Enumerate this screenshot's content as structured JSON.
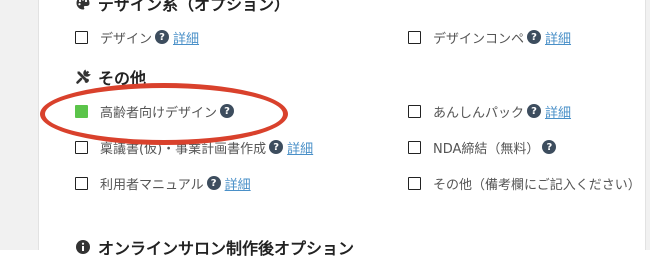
{
  "sections": {
    "design": {
      "title": "デザイン系（オプション）"
    },
    "other": {
      "title": "その他"
    },
    "online": {
      "title": "オンラインサロン制作後オプション"
    }
  },
  "link_label": "詳細",
  "help_glyph": "?",
  "design_options": [
    {
      "label": "デザイン",
      "checked": false,
      "help": true,
      "link": true
    },
    {
      "label": "デザインコンペ",
      "checked": false,
      "help": true,
      "link": true
    }
  ],
  "other_options": [
    {
      "label": "高齢者向けデザイン",
      "checked": true,
      "help": true,
      "link": false
    },
    {
      "label": "あんしんパック",
      "checked": false,
      "help": true,
      "link": true
    },
    {
      "label": "稟議書(仮)・事業計画書作成",
      "checked": false,
      "help": true,
      "link": true
    },
    {
      "label": "NDA締結（無料）",
      "checked": false,
      "help": true,
      "link": false
    },
    {
      "label": "利用者マニュアル",
      "checked": false,
      "help": true,
      "link": true
    },
    {
      "label": "その他（備考欄にご記入ください）",
      "checked": false,
      "help": false,
      "link": false
    }
  ],
  "colors": {
    "checked_box": "#5bc44a",
    "link": "#4a90c8",
    "help_icon": "#3d4d5e",
    "annotation_oval": "#d9412c"
  }
}
